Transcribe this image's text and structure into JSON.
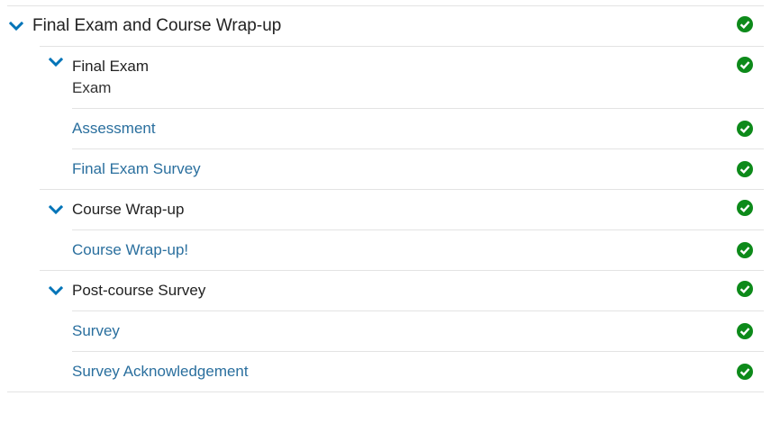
{
  "section": {
    "title": "Final Exam and Course Wrap-up",
    "status": "complete",
    "subsections": [
      {
        "title": "Final Exam",
        "subtitle": "Exam",
        "status": "complete",
        "items": [
          {
            "label": "Assessment",
            "status": "complete"
          },
          {
            "label": "Final Exam Survey",
            "status": "complete"
          }
        ]
      },
      {
        "title": "Course Wrap-up",
        "status": "complete",
        "items": [
          {
            "label": "Course Wrap-up!",
            "status": "complete"
          }
        ]
      },
      {
        "title": "Post-course Survey",
        "status": "complete",
        "items": [
          {
            "label": "Survey",
            "status": "complete"
          },
          {
            "label": "Survey Acknowledgement",
            "status": "complete"
          }
        ]
      }
    ]
  },
  "icons": {
    "expand": "chevron-down-icon",
    "complete": "check-circle-icon"
  },
  "colors": {
    "accent": "#0074b8",
    "link": "#2a6f9e",
    "complete": "#0d8a1a",
    "divider": "#e3e3e3"
  }
}
